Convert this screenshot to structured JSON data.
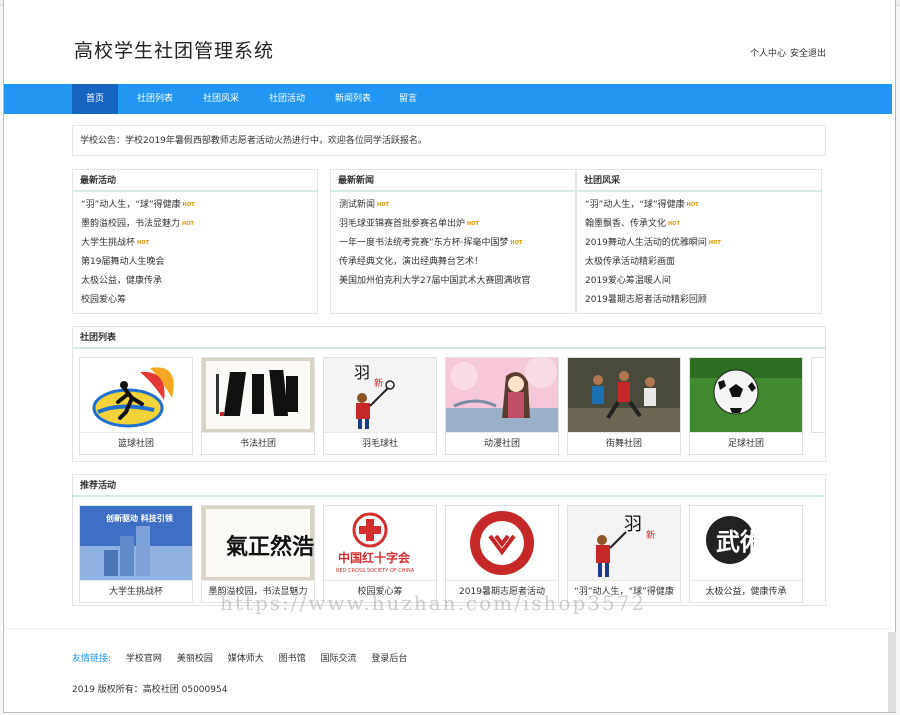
{
  "header": {
    "site_title": "高校学生社团管理系统",
    "user_center": "个人中心",
    "logout": "安全退出"
  },
  "nav": {
    "items": [
      {
        "label": "首页"
      },
      {
        "label": "社团列表"
      },
      {
        "label": "社团风采"
      },
      {
        "label": "社团活动"
      },
      {
        "label": "新闻列表"
      },
      {
        "label": "留言"
      }
    ]
  },
  "notice": {
    "text": "学校公告：学校2019年暑假西部教师志愿者活动火热进行中，欢迎各位同学活跃报名。"
  },
  "latest_activities": {
    "title": "最新活动",
    "hot_tag": "HOT",
    "items": [
      {
        "label": "“羽”动人生，“球”得健康",
        "hot": true
      },
      {
        "label": "墨韵溢校园，书法显魅力",
        "hot": true
      },
      {
        "label": "大学生挑战杯",
        "hot": true
      },
      {
        "label": "第19届舞动人生晚会",
        "hot": false
      },
      {
        "label": "太极公益，健康传承",
        "hot": false
      },
      {
        "label": "校园爱心筹",
        "hot": false
      }
    ]
  },
  "latest_news": {
    "title": "最新新闻",
    "items": [
      {
        "label": "测试新闻",
        "hot": true
      },
      {
        "label": "羽毛球亚锦赛首批参赛名单出炉",
        "hot": true
      },
      {
        "label": "一年一度书法统考竞赛“东方杯·挥毫中国梦",
        "hot": true
      },
      {
        "label": "传承经典文化，演出经典舞台艺术！",
        "hot": false
      },
      {
        "label": "美国加州伯克利大学27届中国武术大赛圆满收官",
        "hot": false
      }
    ]
  },
  "club_style": {
    "title": "社团风采",
    "items": [
      {
        "label": "“羽”动人生，“球”得健康",
        "hot": true
      },
      {
        "label": "翰墨飘香、传承文化",
        "hot": true
      },
      {
        "label": "2019舞动人生活动的优雅瞬间",
        "hot": true
      },
      {
        "label": "太极传承活动精彩画面",
        "hot": false
      },
      {
        "label": "2019爱心筹温暖人间",
        "hot": false
      },
      {
        "label": "2019暑期志愿者活动精彩回顾",
        "hot": false
      }
    ]
  },
  "club_list": {
    "title": "社团列表",
    "cards": [
      {
        "label": "篮球社团"
      },
      {
        "label": "书法社团"
      },
      {
        "label": "羽毛球社"
      },
      {
        "label": "动漫社团"
      },
      {
        "label": "街舞社团"
      },
      {
        "label": "足球社团"
      }
    ]
  },
  "recommended": {
    "title": "推荐活动",
    "cards": [
      {
        "label": "大学生挑战杯",
        "thumb_text": "创新驱动 科技引领"
      },
      {
        "label": "墨韵溢校园，书法显魅力",
        "thumb_text": "氣正然浩"
      },
      {
        "label": "校园爱心筹",
        "thumb_text": "中国红十字会",
        "thumb_sub": "RED CROSS SOCIETY OF CHINA"
      },
      {
        "label": "2019暑期志愿者活动"
      },
      {
        "label": "“羽”动人生，“球”得健康"
      },
      {
        "label": "太极公益，健康传承",
        "thumb_text": "武術"
      }
    ]
  },
  "footer": {
    "links_label": "友情链接:",
    "links": [
      {
        "label": "学校官网"
      },
      {
        "label": "美丽校园"
      },
      {
        "label": "媒体师大"
      },
      {
        "label": "图书馆"
      },
      {
        "label": "国际交流"
      },
      {
        "label": "登录后台"
      }
    ],
    "copyright": "2019 版权所有：高校社团 05000954"
  },
  "watermark": "https://www.huzhan.com/ishop3572",
  "colors": {
    "nav_blue": "#2196f3",
    "nav_active": "#1565c0",
    "hot": "#e09400"
  }
}
